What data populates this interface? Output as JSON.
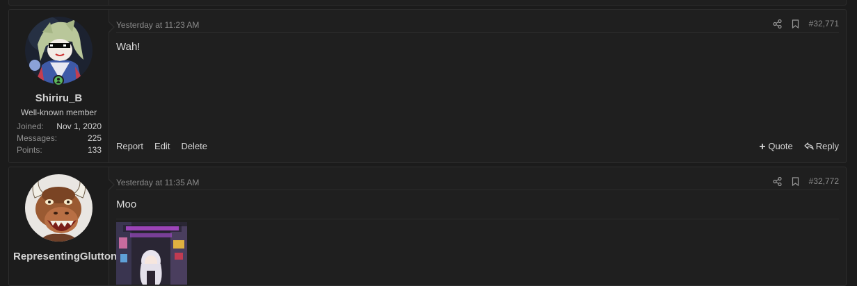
{
  "posts": [
    {
      "username": "Shiriru_B",
      "role": "Well-known member",
      "stats": [
        {
          "label": "Joined:",
          "value": "Nov 1, 2020"
        },
        {
          "label": "Messages:",
          "value": "225"
        },
        {
          "label": "Points:",
          "value": "133"
        }
      ],
      "date": "Yesterday at 11:23 AM",
      "post_number": "#32,771",
      "body": "Wah!",
      "actions_left": [
        "Report",
        "Edit",
        "Delete"
      ],
      "quote_label": "Quote",
      "reply_label": "Reply",
      "online": true
    },
    {
      "username": "RepresentingGluttony",
      "date": "Yesterday at 11:35 AM",
      "post_number": "#32,772",
      "body": "Moo"
    }
  ],
  "icons": {
    "share": "share-icon",
    "bookmark": "bookmark-icon",
    "plus": "plus-icon",
    "reply": "reply-arrow-icon",
    "online": "online-user-icon"
  },
  "colors": {
    "background": "#1b1b1b",
    "panel": "#1f1f1f",
    "online": "#5cb85c",
    "muted_text": "#8a8a8a"
  }
}
